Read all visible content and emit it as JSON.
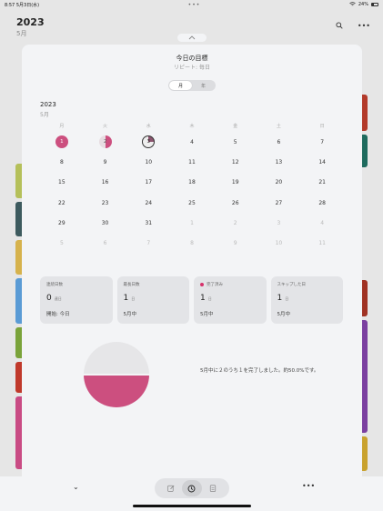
{
  "status_bar": {
    "time": "8:57",
    "date": "5月3日(水)",
    "center": "•••",
    "wifi_signal": "☰",
    "battery": "24%"
  },
  "background": {
    "title": "2023",
    "subtitle": "5月"
  },
  "sheet": {
    "goal_title": "今日の目標",
    "goal_repeat": "リピート: 毎日",
    "segments": [
      "月",
      "年"
    ],
    "calendar": {
      "year": "2023",
      "month": "5月",
      "weekdays": [
        "月",
        "火",
        "水",
        "木",
        "金",
        "土",
        "日"
      ],
      "weeks": [
        [
          {
            "d": "1",
            "s": "full"
          },
          {
            "d": "2",
            "s": "partial"
          },
          {
            "d": "3",
            "s": "today"
          },
          {
            "d": "4"
          },
          {
            "d": "5"
          },
          {
            "d": "6"
          },
          {
            "d": "7"
          }
        ],
        [
          {
            "d": "8"
          },
          {
            "d": "9"
          },
          {
            "d": "10"
          },
          {
            "d": "11"
          },
          {
            "d": "12"
          },
          {
            "d": "13"
          },
          {
            "d": "14"
          }
        ],
        [
          {
            "d": "15"
          },
          {
            "d": "16"
          },
          {
            "d": "17"
          },
          {
            "d": "18"
          },
          {
            "d": "19"
          },
          {
            "d": "20"
          },
          {
            "d": "21"
          }
        ],
        [
          {
            "d": "22"
          },
          {
            "d": "23"
          },
          {
            "d": "24"
          },
          {
            "d": "25"
          },
          {
            "d": "26"
          },
          {
            "d": "27"
          },
          {
            "d": "28"
          }
        ],
        [
          {
            "d": "29"
          },
          {
            "d": "30"
          },
          {
            "d": "31"
          },
          {
            "d": "1",
            "o": true
          },
          {
            "d": "2",
            "o": true
          },
          {
            "d": "3",
            "o": true
          },
          {
            "d": "4",
            "o": true
          }
        ],
        [
          {
            "d": "5",
            "o": true
          },
          {
            "d": "6",
            "o": true
          },
          {
            "d": "7",
            "o": true
          },
          {
            "d": "8",
            "o": true
          },
          {
            "d": "9",
            "o": true
          },
          {
            "d": "10",
            "o": true
          },
          {
            "d": "11",
            "o": true
          }
        ]
      ]
    },
    "stats": [
      {
        "label": "連続日数",
        "value": "0",
        "unit": "連日",
        "foot": "開始: 今日",
        "dot": false
      },
      {
        "label": "最長日数",
        "value": "1",
        "unit": "日",
        "foot": "5月中",
        "dot": false
      },
      {
        "label": "完了済み",
        "value": "1",
        "unit": "日",
        "foot": "5月中",
        "dot": true
      },
      {
        "label": "スキップした日",
        "value": "1",
        "unit": "日",
        "foot": "5月中",
        "dot": false
      }
    ],
    "pie": {
      "completed_fraction": 0.5,
      "completed_color": "#cc4f7f",
      "remaining_color": "#e6e6e8"
    },
    "summary": "5月中に２のうち１を完了しました。約50.0%です。"
  },
  "toolbar": {
    "chevron": "⌄",
    "more": "•••",
    "buttons": [
      "edit-icon",
      "clock-icon",
      "delete-icon"
    ]
  },
  "colors": {
    "accent": "#cc4f7f"
  }
}
